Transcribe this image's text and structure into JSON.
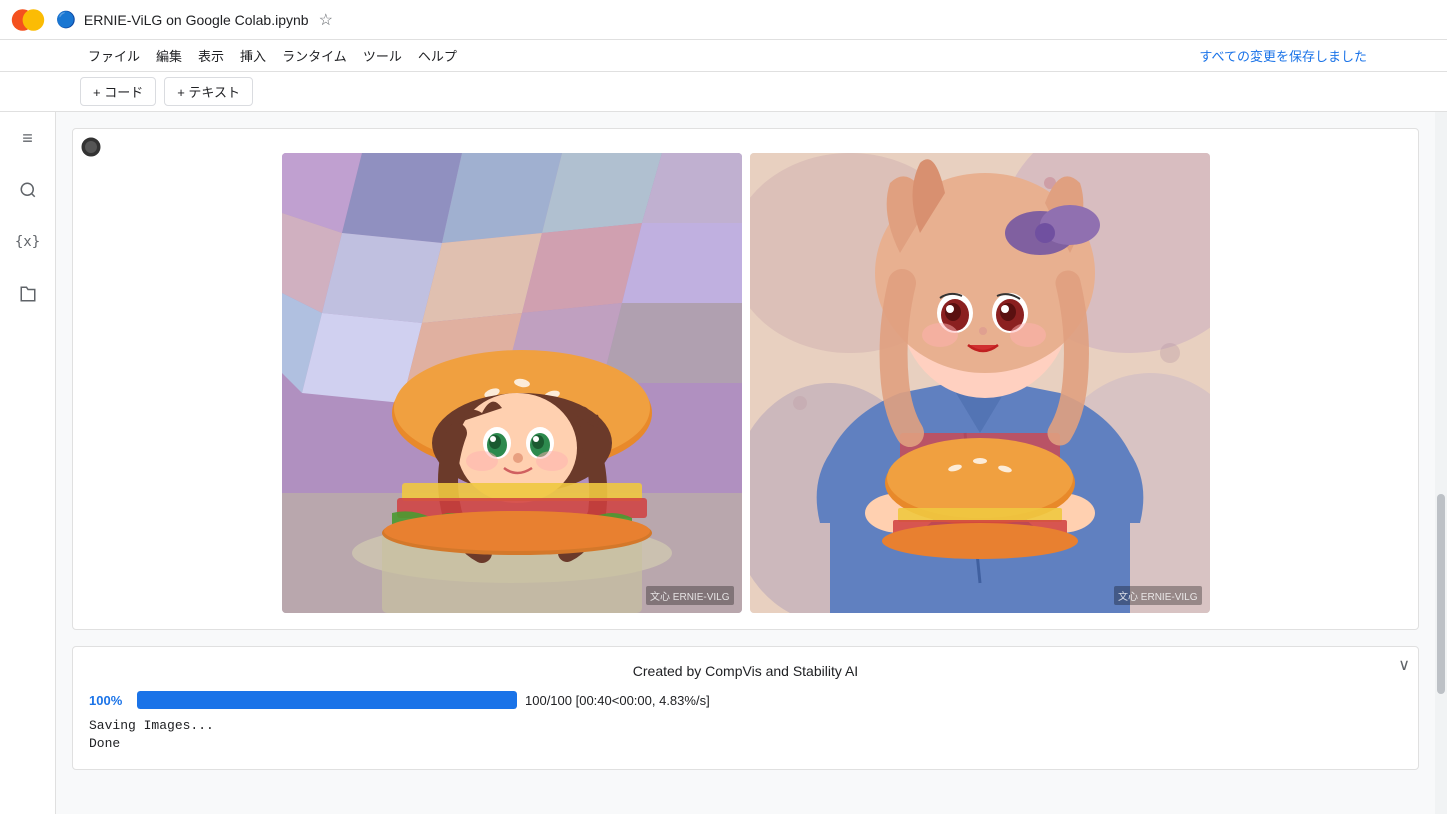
{
  "logo": {
    "text": "CO",
    "colors": {
      "orange": "#F4511E",
      "yellow": "#FBBC04"
    }
  },
  "tab": {
    "drive_icon": "📁",
    "title": "ERNIE-ViLG on Google Colab.ipynb",
    "star_icon": "☆"
  },
  "menu": {
    "items": [
      "ファイル",
      "編集",
      "表示",
      "挿入",
      "ランタイム",
      "ツール",
      "ヘルプ"
    ],
    "save_status": "すべての変更を保存しました"
  },
  "toolbar": {
    "add_code_label": "+ コード",
    "add_text_label": "+ テキスト"
  },
  "sidebar": {
    "icons": [
      "≡",
      "🔍",
      "{x}",
      "📁"
    ]
  },
  "cell": {
    "run_indicator": "⏺",
    "images": [
      {
        "watermark": "文心 ERNIE-VILG",
        "alt": "Anime girl burger illustration 1"
      },
      {
        "watermark": "文心 ERNIE-VILG",
        "alt": "Anime girl burger illustration 2"
      }
    ]
  },
  "bottom_output": {
    "collapse_icon": "∨",
    "credits": "Created by CompVis and Stability AI",
    "progress": {
      "percent": "100%",
      "fill_width": "100",
      "stats": "100/100 [00:40<00:00, 4.83%/s]"
    },
    "terminal_lines": [
      "Saving Images...",
      "Done"
    ]
  }
}
